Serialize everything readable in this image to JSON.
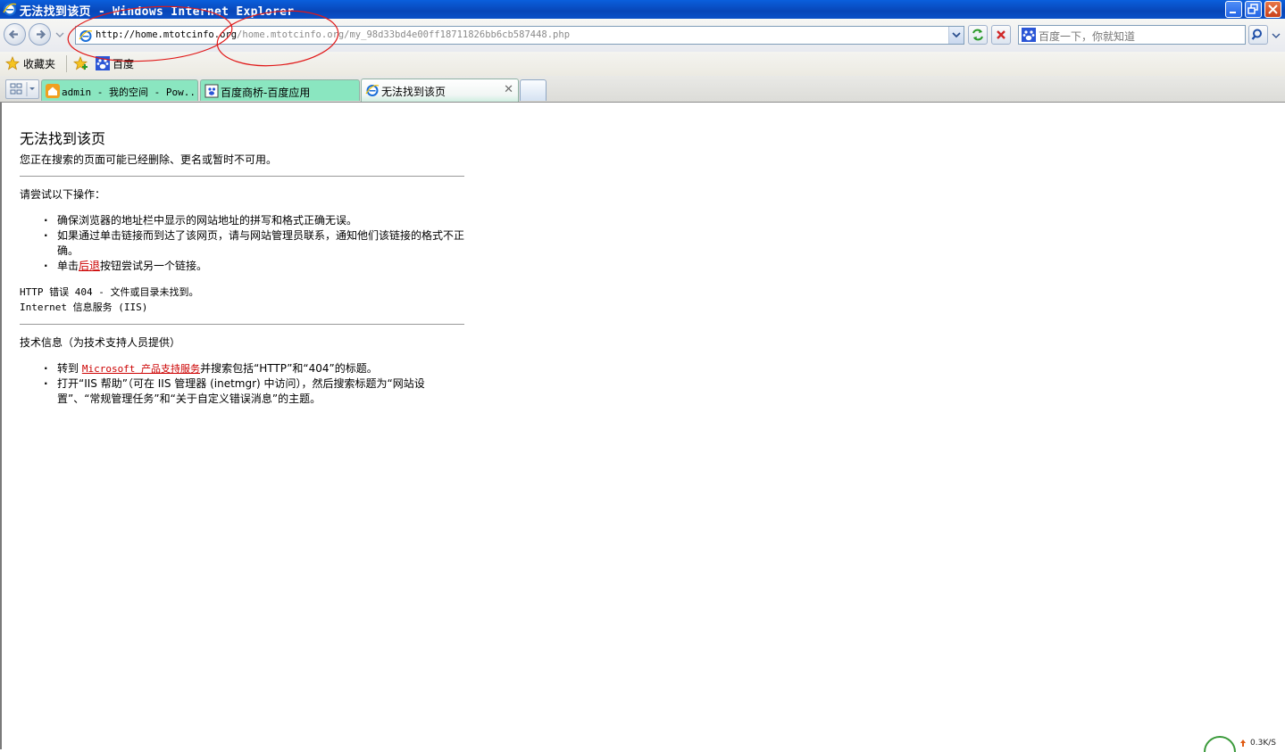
{
  "window": {
    "title": "无法找到该页 - Windows Internet Explorer"
  },
  "navigation": {
    "address_host": "http://home.mtotcinfo.org",
    "address_path": "/home.mtotcinfo.org/my_98d33bd4e00ff18711826bb6cb587448.php",
    "search_placeholder": "百度一下，你就知道"
  },
  "favorites_bar": {
    "favorites_label": "收藏夹",
    "baidu_label": "百度"
  },
  "tabs": [
    {
      "label": "admin - 我的空间 - Pow...",
      "active": false
    },
    {
      "label": "百度商桥-百度应用",
      "active": false
    },
    {
      "label": "无法找到该页",
      "active": true
    }
  ],
  "error_page": {
    "title": "无法找到该页",
    "subtitle": "您正在搜索的页面可能已经删除、更名或暂时不可用。",
    "try_heading": "请尝试以下操作：",
    "try_items": {
      "item1": "确保浏览器的地址栏中显示的网站地址的拼写和格式正确无误。",
      "item2": "如果通过单击链接而到达了该网页，请与网站管理员联系，通知他们该链接的格式不正确。",
      "item3_before": "单击",
      "item3_link": "后退",
      "item3_after": "按钮尝试另一个链接。"
    },
    "http_error": "HTTP 错误 404 - 文件或目录未找到。",
    "server_info": "Internet 信息服务 (IIS)",
    "tech_heading": "技术信息（为技术支持人员提供）",
    "tech_items": {
      "item1_before": "转到 ",
      "item1_link": "Microsoft 产品支持服务",
      "item1_after": "并搜索包括“HTTP”和“404”的标题。",
      "item2": "打开“IIS 帮助”（可在 IIS 管理器 (inetmgr) 中访问），然后搜索标题为“网站设置”、“常规管理任务”和“关于自定义错误消息”的主题。"
    }
  },
  "status": {
    "net_rate": "0.3K/S"
  },
  "colors": {
    "titlebar": "#0846b8",
    "tab_inactive": "#8ae6c0",
    "link": "#cc0000",
    "annotation": "#e01818"
  }
}
